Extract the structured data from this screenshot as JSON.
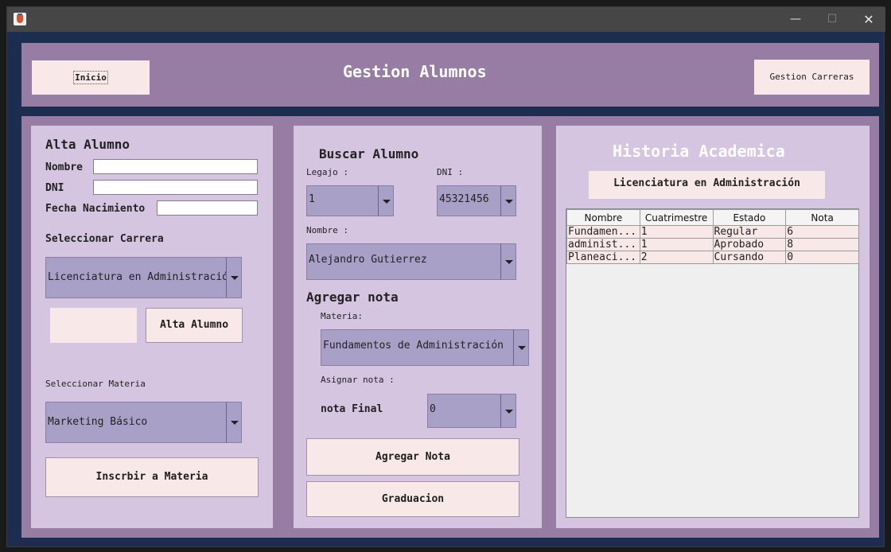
{
  "window": {
    "title": ""
  },
  "header": {
    "inicio_label": "Inicio",
    "title": "Gestion Alumnos",
    "carreras_label": "Gestion Carreras"
  },
  "alta": {
    "title": "Alta Alumno",
    "nombre_label": "Nombre",
    "dni_label": "DNI",
    "fecha_label": "Fecha Nacimiento",
    "carrera_label": "Seleccionar Carrera",
    "carrera_value": "Licenciatura en Administración",
    "alta_button": "Alta Alumno",
    "materia_label": "Seleccionar Materia",
    "materia_value": "Marketing Básico",
    "inscribir_button": "Inscrbir a Materia"
  },
  "buscar": {
    "title": "Buscar Alumno",
    "legajo_label": "Legajo :",
    "legajo_value": "1",
    "dni_label": "DNI :",
    "dni_value": "45321456",
    "nombre_label": "Nombre :",
    "nombre_value": "Alejandro Gutierrez",
    "nota_title": "Agregar nota",
    "materia_label": "Materia:",
    "materia_value": "Fundamentos de Administración",
    "asignar_label": "Asignar nota :",
    "nota_final_label": "nota Final",
    "nota_value": "0",
    "agregar_button": "Agregar Nota",
    "graduacion_button": "Graduacion"
  },
  "historia": {
    "title": "Historia Academica",
    "carrera": "Licenciatura en Administración",
    "columns": [
      "Nombre",
      "Cuatrimestre",
      "Estado",
      "Nota"
    ],
    "rows": [
      [
        "Fundamen...",
        "1",
        "Regular",
        "6"
      ],
      [
        "administ...",
        "1",
        "Aprobado",
        "8"
      ],
      [
        "Planeaci...",
        "2",
        "Cursando",
        "0"
      ]
    ]
  }
}
